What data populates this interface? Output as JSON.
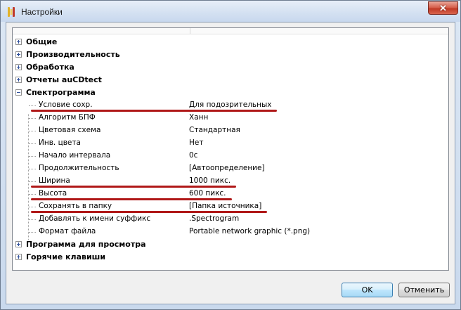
{
  "window": {
    "title": "Настройки",
    "close_glyph": "✕"
  },
  "tree": {
    "categories_top": [
      {
        "label": "Общие",
        "expander": "plus"
      },
      {
        "label": "Производительность",
        "expander": "plus"
      },
      {
        "label": "Обработка",
        "expander": "plus"
      },
      {
        "label": "Отчеты auCDtect",
        "expander": "plus"
      },
      {
        "label": "Спектрограмма",
        "expander": "minus"
      }
    ],
    "spectrogram_props": [
      {
        "label": "Условие сохр.",
        "value": "Для подозрительных",
        "highlighted": true
      },
      {
        "label": "Алгоритм БПФ",
        "value": "Ханн",
        "highlighted": false
      },
      {
        "label": "Цветовая схема",
        "value": "Стандартная",
        "highlighted": false
      },
      {
        "label": "Инв. цвета",
        "value": "Нет",
        "highlighted": false
      },
      {
        "label": "Начало интервала",
        "value": "0с",
        "highlighted": false
      },
      {
        "label": "Продолжительность",
        "value": "[Автоопределение]",
        "highlighted": false
      },
      {
        "label": "Ширина",
        "value": "1000 пикс.",
        "highlighted": true
      },
      {
        "label": "Высота",
        "value": "600 пикс.",
        "highlighted": true
      },
      {
        "label": "Сохранять в папку",
        "value": "[Папка источника]",
        "highlighted": true
      },
      {
        "label": "Добавлять к имени суффикс",
        "value": ".Spectrogram",
        "highlighted": false
      },
      {
        "label": "Формат файла",
        "value": "Portable network graphic (*.png)",
        "highlighted": false
      }
    ],
    "categories_bottom": [
      {
        "label": "Программа для просмотра",
        "expander": "plus"
      },
      {
        "label": "Горячие клавиши",
        "expander": "plus"
      }
    ]
  },
  "buttons": {
    "ok": "OK",
    "cancel": "Отменить"
  },
  "colors": {
    "highlight_underline": "#b01818",
    "default_button_border": "#3c7fb1"
  }
}
